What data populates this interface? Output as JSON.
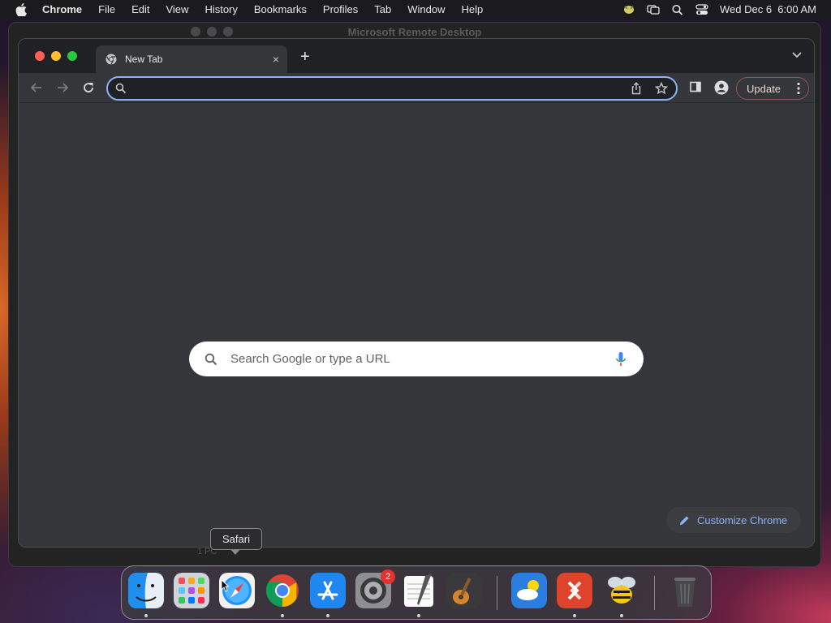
{
  "menubar": {
    "app_name": "Chrome",
    "items": [
      "File",
      "Edit",
      "View",
      "History",
      "Bookmarks",
      "Profiles",
      "Tab",
      "Window",
      "Help"
    ],
    "datetime": "Wed Dec 6  6:00 AM",
    "icons": [
      "apple-icon",
      "extension-icon",
      "screen-mirroring-icon",
      "spotlight-icon",
      "control-center-icon"
    ]
  },
  "background_window": {
    "title": "Microsoft Remote Desktop",
    "subtitle": "1 PC"
  },
  "browser": {
    "tab": {
      "title": "New Tab",
      "close": "×"
    },
    "new_tab": "+",
    "omnibox": {
      "value": "",
      "placeholder": ""
    },
    "update_label": "Update",
    "search": {
      "placeholder": "Search Google or type a URL"
    },
    "customize_label": "Customize Chrome"
  },
  "colors": {
    "accent": "#8ab4f8",
    "tabstrip": "#202124",
    "toolbar": "#35363a",
    "traffic_close": "#ff5f57",
    "traffic_minimize": "#febc2e",
    "traffic_zoom": "#28c840",
    "badge": "#e5322d"
  },
  "tooltip": {
    "text": "Safari"
  },
  "dock": {
    "apps": [
      {
        "name": "Finder",
        "icon": "finder-icon",
        "running": true
      },
      {
        "name": "Launchpad",
        "icon": "launchpad-icon",
        "running": false
      },
      {
        "name": "Safari",
        "icon": "safari-icon",
        "running": false
      },
      {
        "name": "Google Chrome",
        "icon": "chrome-icon",
        "running": true
      },
      {
        "name": "App Store",
        "icon": "app-store-icon",
        "running": true
      },
      {
        "name": "System Settings",
        "icon": "system-settings-icon",
        "running": false,
        "badge": "2"
      },
      {
        "name": "TextEdit",
        "icon": "textedit-icon",
        "running": true
      },
      {
        "name": "GarageBand",
        "icon": "garageband-icon",
        "running": false
      },
      {
        "name": "Weather",
        "icon": "weather-icon",
        "running": false
      },
      {
        "name": "Microsoft Remote Desktop",
        "icon": "remote-desktop-icon",
        "running": true
      },
      {
        "name": "Bee",
        "icon": "bee-icon",
        "running": true
      },
      {
        "name": "Trash",
        "icon": "trash-icon",
        "running": false
      }
    ]
  }
}
